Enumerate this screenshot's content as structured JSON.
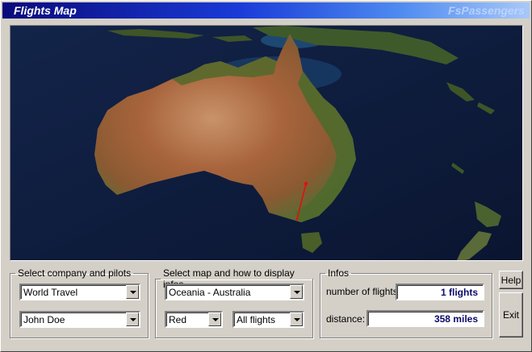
{
  "window": {
    "title": "Flights Map",
    "brand": "FsPassengers"
  },
  "company_group": {
    "legend": "Select company and pilots",
    "company_value": "World Travel",
    "pilot_value": "John Doe"
  },
  "map_group": {
    "legend": "Select map and how to display infos",
    "map_value": "Oceania - Australia",
    "color_value": "Red",
    "filter_value": "All flights"
  },
  "infos_group": {
    "legend": "Infos",
    "flights_label": "number of flights:",
    "flights_value": "1 flights",
    "distance_label": "distance:",
    "distance_value": "358 miles"
  },
  "buttons": {
    "help": "Help",
    "exit": "Exit"
  },
  "colors": {
    "route": "#e01010",
    "ocean": "#0b1630",
    "title_gradient_start": "#0a0a7a"
  }
}
